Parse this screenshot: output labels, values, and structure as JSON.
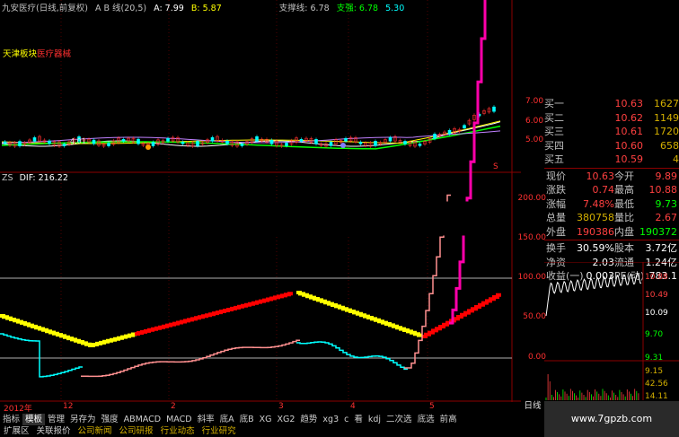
{
  "colors": {
    "grid_red": "#8b0000",
    "yellow": "#ffff00",
    "red": "#ff0000",
    "cyan": "#00ffff",
    "pink": "#ff8080",
    "magenta": "#ff00aa",
    "green": "#00ff00",
    "gold": "#d4b000"
  },
  "header": {
    "stock": "九安医疗(日线,前复权)",
    "indicator": "A B 线(20,5)",
    "a_val": "A: 7.99",
    "b_val": "B: 5.87",
    "support": "支撑线: 6.78",
    "strong": "支强: 6.78",
    "third": "5.30"
  },
  "overlay": {
    "sector1": "天津板块",
    "sector2": "医疗器械",
    "price_label": "4.01"
  },
  "upper_axis": [
    "7.00",
    "6.00",
    "5.00"
  ],
  "lower": {
    "name": "ZS",
    "dif": "DIF: 216.22",
    "axis": [
      "200.00",
      "150.00",
      "100.00",
      "50.00",
      "0.00"
    ]
  },
  "time_axis": [
    "2012年",
    "12",
    "2",
    "3",
    "4",
    "5"
  ],
  "quote": {
    "asks": [
      {
        "label": "买一",
        "price": "10.63",
        "vol": "1627"
      },
      {
        "label": "买二",
        "price": "10.62",
        "vol": "1149"
      },
      {
        "label": "买三",
        "price": "10.61",
        "vol": "1720"
      },
      {
        "label": "买四",
        "price": "10.60",
        "vol": "658"
      },
      {
        "label": "买五",
        "price": "10.59",
        "vol": "4"
      }
    ],
    "pairs": [
      {
        "l1": "现价",
        "v1": "10.63",
        "l2": "今开",
        "v2": "9.89",
        "c1": "#ff4040",
        "c2": "#ff4040"
      },
      {
        "l1": "涨跌",
        "v1": "0.74",
        "l2": "最高",
        "v2": "10.88",
        "c1": "#ff4040",
        "c2": "#ff4040"
      },
      {
        "l1": "涨幅",
        "v1": "7.48%",
        "l2": "最低",
        "v2": "9.73",
        "c1": "#ff4040",
        "c2": "#00ff00"
      },
      {
        "l1": "总量",
        "v1": "380758",
        "l2": "量比",
        "v2": "2.67",
        "c1": "#d4b000",
        "c2": "#ff4040"
      },
      {
        "l1": "外盘",
        "v1": "190386",
        "l2": "内盘",
        "v2": "190372",
        "c1": "#ff4040",
        "c2": "#00ff00"
      }
    ],
    "pairs2": [
      {
        "l1": "换手",
        "v1": "30.59%",
        "l2": "股本",
        "v2": "3.72亿"
      },
      {
        "l1": "净资",
        "v1": "2.03",
        "l2": "流通",
        "v2": "1.24亿"
      },
      {
        "l1": "收益(一)",
        "v1": "0.003",
        "l2": "PE(动)",
        "v2": "783.1"
      }
    ]
  },
  "mini_axis": [
    "10.88",
    "10.49",
    "10.09",
    "9.70",
    "9.31"
  ],
  "mini_vol": [
    "9.15",
    "42.56",
    "14.11"
  ],
  "day_button": "日线",
  "tabs": [
    "指标",
    "模板",
    "管理",
    "另存为",
    "强度",
    "ABMACD",
    "MACD",
    "斜率",
    "底A",
    "底B",
    "XG",
    "XG2",
    "趋势",
    "xg3",
    "c",
    "看",
    "kdj",
    "二次选",
    "底选",
    "前高"
  ],
  "tabs_active": "模板",
  "tabs2": [
    "扩展区",
    "关联报价",
    "公司新闻",
    "公司研报",
    "行业动态",
    "行业研究"
  ],
  "watermark": "www.7gpzb.com"
}
